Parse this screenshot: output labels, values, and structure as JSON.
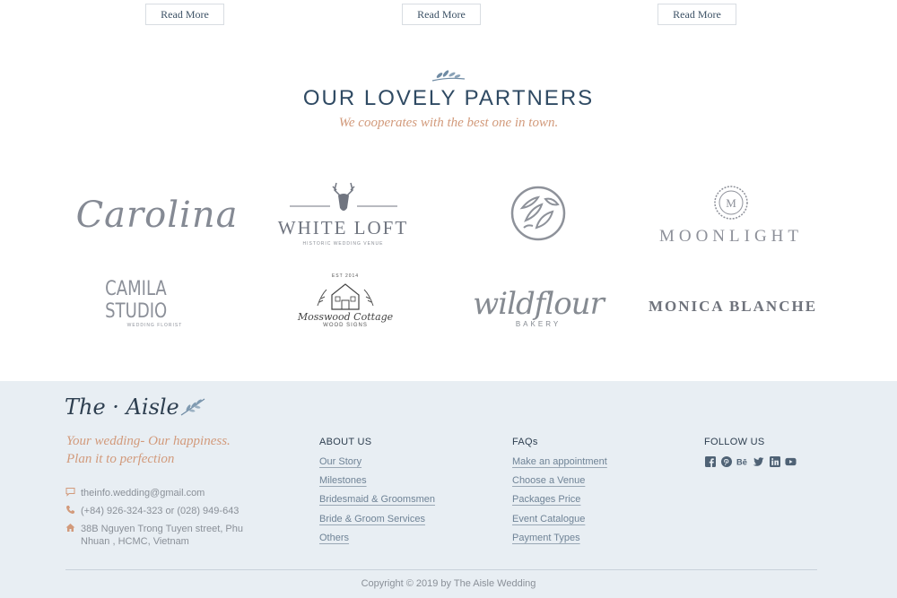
{
  "read_more": {
    "label": "Read More"
  },
  "partners": {
    "title": "OUR LOVELY PARTNERS",
    "subtitle": "We cooperates with the best one in town.",
    "logos": {
      "carolina": "Carolina",
      "white_loft": "WHITE LOFT",
      "white_loft_tag": "HISTORIC WEDDING VENUE",
      "moonlight": "MOONLIGHT",
      "moonlight_mark": "M",
      "camila": "CAMILA STUDIO",
      "camila_tag": "WEDDING FLORIST",
      "mosswood_est": "EST 2014",
      "mosswood": "Mosswood Cottage",
      "mosswood_tag": "WOOD SIGNS",
      "wildflour": "wildflour",
      "wildflour_tag": "BAKERY",
      "monica": "MONICA BLANCHE"
    }
  },
  "footer": {
    "brand": "The · Aisle",
    "tagline_1": "Your wedding- Our happiness.",
    "tagline_2": "Plan it to perfection",
    "email": "theinfo.wedding@gmail.com",
    "phone": "(+84) 926-324-323 or (028) 949-643",
    "address_1": "38B Nguyen Trong Tuyen street, Phu",
    "address_2": "Nhuan , HCMC, Vietnam",
    "about": {
      "title": "ABOUT US",
      "links": [
        "Our Story",
        "Milestones",
        "Bridesmaid & Groomsmen",
        "Bride & Groom Services",
        "Others"
      ]
    },
    "faqs": {
      "title": "FAQs",
      "links": [
        "Make an appointment",
        "Choose a Venue",
        "Packages Price",
        "Event Catalogue",
        "Payment Types"
      ]
    },
    "follow": {
      "title": "FOLLOW US",
      "icons": [
        "facebook-icon",
        "pinterest-icon",
        "behance-icon",
        "twitter-icon",
        "linkedin-icon",
        "youtube-icon"
      ]
    },
    "copyright": "Copyright © 2019 by The Aisle Wedding"
  },
  "colors": {
    "accent": "#d29a7b",
    "navy": "#2f4a63",
    "footer_bg": "#e8eef3"
  }
}
